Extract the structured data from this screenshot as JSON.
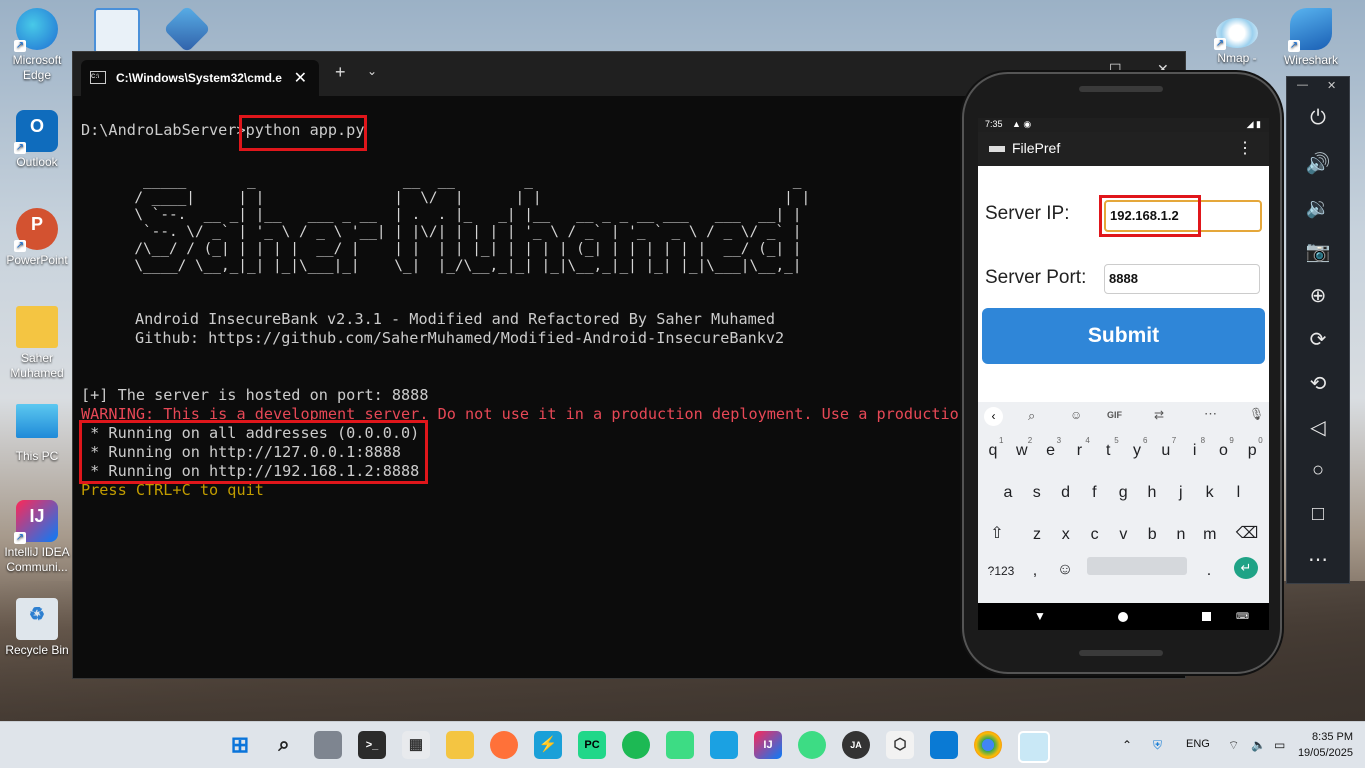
{
  "desktop": {
    "icons": [
      {
        "label": "Microsoft Edge",
        "icon": "edge-icon",
        "color": "#1f8ad8"
      },
      {
        "label": "Outlook",
        "icon": "outlook-icon",
        "color": "#0f6cbd"
      },
      {
        "label": "PowerPoint",
        "icon": "powerpoint-icon",
        "color": "#d35230"
      },
      {
        "label": "Saher Muhamed",
        "icon": "folder-icon",
        "color": "#f4c542"
      },
      {
        "label": "This PC",
        "icon": "monitor-icon",
        "color": "#36a8e0"
      },
      {
        "label": "IntelliJ IDEA Communi...",
        "icon": "intellij-icon",
        "color": "#1d1d1d"
      },
      {
        "label": "Recycle Bin",
        "icon": "recycle-bin-icon",
        "color": "#cfd8e0"
      }
    ],
    "right_icons": [
      {
        "label": "Nmap -",
        "icon": "nmap-icon"
      },
      {
        "label": "Wireshark",
        "icon": "wireshark-icon"
      }
    ]
  },
  "terminal": {
    "tab_title": "C:\\Windows\\System32\\cmd.e",
    "prompt": "D:\\AndroLabServer>",
    "command": "python app.py",
    "banner_ascii": [
      "   _____       _                 __  __        _                              _ ",
      "  / ____|     | |               |  \\/  |      | |                            | |",
      "  \\ `--.  __ _| |__   ___ _ __  | .  . |_   _| |__   __ _ _ __ ___   ___  __| |",
      "   `--. \\/ _` | '_ \\ / _ \\ '__| | |\\/| | | | | '_ \\ / _` | '_ ` _ \\ / _ \\/ _` |",
      "  /\\__/ / (_| | | | |  __/ |    | |  | | |_| | | | | (_| | | | | | |  __/ (_| |",
      "  \\____/ \\__,_|_| |_|\\___|_|    \\_|  |_/\\__,_|_| |_|\\__,_|_| |_| |_|\\___|\\__,_|"
    ],
    "banner_line1": "Android InsecureBank v2.3.1 - Modified and Refactored By Saher Muhamed",
    "banner_line2": "Github: https://github.com/SaherMuhamed/Modified-Android-InsecureBankv2",
    "hosted": "[+] The server is hosted on port: 8888",
    "warning": "WARNING: This is a development server. Do not use it in a production deployment. Use a production",
    "running1": " * Running on all addresses (0.0.0.0)",
    "running2": " * Running on http://127.0.0.1:8888",
    "running3": " * Running on http://192.168.1.2:8888",
    "quit": "Press CTRL+C to quit"
  },
  "phone": {
    "time": "7:35",
    "app_title": "FilePref",
    "ip_label": "Server IP:",
    "ip_value": "192.168.1.2",
    "port_label": "Server Port:",
    "port_value": "8888",
    "submit": "Submit",
    "kb_gif": "GIF",
    "row1": [
      "q",
      "w",
      "e",
      "r",
      "t",
      "y",
      "u",
      "i",
      "o",
      "p"
    ],
    "row1_nums": [
      "1",
      "2",
      "3",
      "4",
      "5",
      "6",
      "7",
      "8",
      "9",
      "0"
    ],
    "row2": [
      "a",
      "s",
      "d",
      "f",
      "g",
      "h",
      "j",
      "k",
      "l"
    ],
    "row3": [
      "z",
      "x",
      "c",
      "v",
      "b",
      "n",
      "m"
    ],
    "sym": "?123",
    "comma": ",",
    "period": "."
  },
  "taskbar": {
    "lang": "ENG",
    "time": "8:35 PM",
    "date": "19/05/2025"
  }
}
